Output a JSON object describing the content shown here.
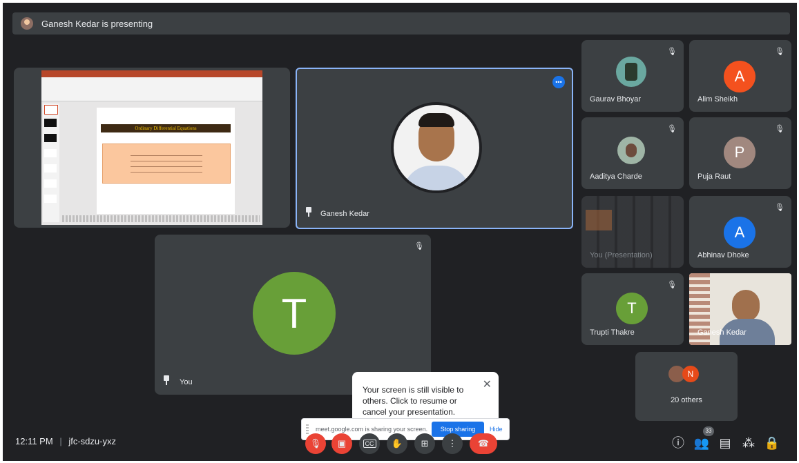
{
  "presenting_banner": "Ganesh Kedar is presenting",
  "tiles": {
    "presenting_name": "Ganesh Kedar",
    "you": {
      "initial": "T",
      "name": "You"
    },
    "gaurav": {
      "name": "Gaurav Bhoyar"
    },
    "alim": {
      "initial": "A",
      "name": "Alim Sheikh"
    },
    "aaditya": {
      "name": "Aaditya Charde"
    },
    "puja": {
      "initial": "P",
      "name": "Puja Raut"
    },
    "you_presentation": {
      "name": "You (Presentation)"
    },
    "abhinav": {
      "initial": "A",
      "name": "Abhinav Dhoke"
    },
    "trupti": {
      "initial": "T",
      "name": "Trupti Thakre"
    },
    "ganesh_cam": {
      "name": "Ganesh Kedar"
    },
    "others": {
      "initial": "N",
      "label": "20 others"
    }
  },
  "slide": {
    "title": "Ordinary Differential Equations"
  },
  "toast": {
    "text": "Your screen is still visible to others. Click to resume or cancel your presentation."
  },
  "sharebar": {
    "text": "meet.google.com is sharing your screen.",
    "stop": "Stop sharing",
    "hide": "Hide"
  },
  "meeting": {
    "time": "12:11 PM",
    "separator": "|",
    "code": "jfc-sdzu-yxz"
  },
  "participants_count": "33",
  "colors": {
    "alim": "#f4511e",
    "puja": "#a1887f",
    "abhinav": "#1a73e8",
    "trupti": "#689f38",
    "you": "#689f38",
    "end_call": "#ea4335",
    "accent": "#1a73e8"
  }
}
